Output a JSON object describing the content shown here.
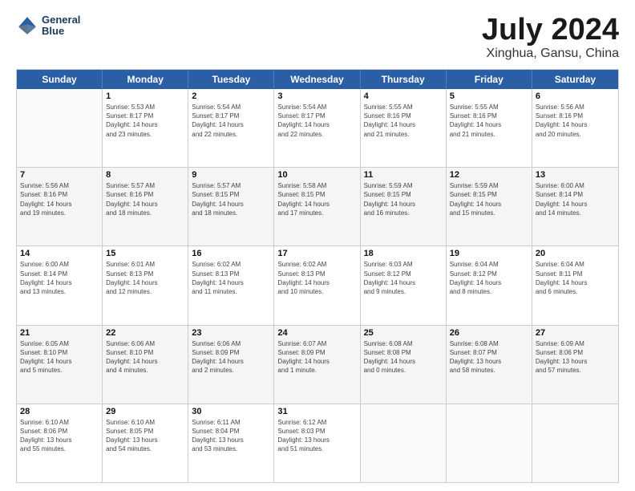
{
  "header": {
    "logo_line1": "General",
    "logo_line2": "Blue",
    "title": "July 2024",
    "subtitle": "Xinghua, Gansu, China"
  },
  "weekdays": [
    "Sunday",
    "Monday",
    "Tuesday",
    "Wednesday",
    "Thursday",
    "Friday",
    "Saturday"
  ],
  "rows": [
    [
      {
        "num": "",
        "info": ""
      },
      {
        "num": "1",
        "info": "Sunrise: 5:53 AM\nSunset: 8:17 PM\nDaylight: 14 hours\nand 23 minutes."
      },
      {
        "num": "2",
        "info": "Sunrise: 5:54 AM\nSunset: 8:17 PM\nDaylight: 14 hours\nand 22 minutes."
      },
      {
        "num": "3",
        "info": "Sunrise: 5:54 AM\nSunset: 8:17 PM\nDaylight: 14 hours\nand 22 minutes."
      },
      {
        "num": "4",
        "info": "Sunrise: 5:55 AM\nSunset: 8:16 PM\nDaylight: 14 hours\nand 21 minutes."
      },
      {
        "num": "5",
        "info": "Sunrise: 5:55 AM\nSunset: 8:16 PM\nDaylight: 14 hours\nand 21 minutes."
      },
      {
        "num": "6",
        "info": "Sunrise: 5:56 AM\nSunset: 8:16 PM\nDaylight: 14 hours\nand 20 minutes."
      }
    ],
    [
      {
        "num": "7",
        "info": "Sunrise: 5:56 AM\nSunset: 8:16 PM\nDaylight: 14 hours\nand 19 minutes."
      },
      {
        "num": "8",
        "info": "Sunrise: 5:57 AM\nSunset: 8:16 PM\nDaylight: 14 hours\nand 18 minutes."
      },
      {
        "num": "9",
        "info": "Sunrise: 5:57 AM\nSunset: 8:15 PM\nDaylight: 14 hours\nand 18 minutes."
      },
      {
        "num": "10",
        "info": "Sunrise: 5:58 AM\nSunset: 8:15 PM\nDaylight: 14 hours\nand 17 minutes."
      },
      {
        "num": "11",
        "info": "Sunrise: 5:59 AM\nSunset: 8:15 PM\nDaylight: 14 hours\nand 16 minutes."
      },
      {
        "num": "12",
        "info": "Sunrise: 5:59 AM\nSunset: 8:15 PM\nDaylight: 14 hours\nand 15 minutes."
      },
      {
        "num": "13",
        "info": "Sunrise: 6:00 AM\nSunset: 8:14 PM\nDaylight: 14 hours\nand 14 minutes."
      }
    ],
    [
      {
        "num": "14",
        "info": "Sunrise: 6:00 AM\nSunset: 8:14 PM\nDaylight: 14 hours\nand 13 minutes."
      },
      {
        "num": "15",
        "info": "Sunrise: 6:01 AM\nSunset: 8:13 PM\nDaylight: 14 hours\nand 12 minutes."
      },
      {
        "num": "16",
        "info": "Sunrise: 6:02 AM\nSunset: 8:13 PM\nDaylight: 14 hours\nand 11 minutes."
      },
      {
        "num": "17",
        "info": "Sunrise: 6:02 AM\nSunset: 8:13 PM\nDaylight: 14 hours\nand 10 minutes."
      },
      {
        "num": "18",
        "info": "Sunrise: 6:03 AM\nSunset: 8:12 PM\nDaylight: 14 hours\nand 9 minutes."
      },
      {
        "num": "19",
        "info": "Sunrise: 6:04 AM\nSunset: 8:12 PM\nDaylight: 14 hours\nand 8 minutes."
      },
      {
        "num": "20",
        "info": "Sunrise: 6:04 AM\nSunset: 8:11 PM\nDaylight: 14 hours\nand 6 minutes."
      }
    ],
    [
      {
        "num": "21",
        "info": "Sunrise: 6:05 AM\nSunset: 8:10 PM\nDaylight: 14 hours\nand 5 minutes."
      },
      {
        "num": "22",
        "info": "Sunrise: 6:06 AM\nSunset: 8:10 PM\nDaylight: 14 hours\nand 4 minutes."
      },
      {
        "num": "23",
        "info": "Sunrise: 6:06 AM\nSunset: 8:09 PM\nDaylight: 14 hours\nand 2 minutes."
      },
      {
        "num": "24",
        "info": "Sunrise: 6:07 AM\nSunset: 8:09 PM\nDaylight: 14 hours\nand 1 minute."
      },
      {
        "num": "25",
        "info": "Sunrise: 6:08 AM\nSunset: 8:08 PM\nDaylight: 14 hours\nand 0 minutes."
      },
      {
        "num": "26",
        "info": "Sunrise: 6:08 AM\nSunset: 8:07 PM\nDaylight: 13 hours\nand 58 minutes."
      },
      {
        "num": "27",
        "info": "Sunrise: 6:09 AM\nSunset: 8:06 PM\nDaylight: 13 hours\nand 57 minutes."
      }
    ],
    [
      {
        "num": "28",
        "info": "Sunrise: 6:10 AM\nSunset: 8:06 PM\nDaylight: 13 hours\nand 55 minutes."
      },
      {
        "num": "29",
        "info": "Sunrise: 6:10 AM\nSunset: 8:05 PM\nDaylight: 13 hours\nand 54 minutes."
      },
      {
        "num": "30",
        "info": "Sunrise: 6:11 AM\nSunset: 8:04 PM\nDaylight: 13 hours\nand 53 minutes."
      },
      {
        "num": "31",
        "info": "Sunrise: 6:12 AM\nSunset: 8:03 PM\nDaylight: 13 hours\nand 51 minutes."
      },
      {
        "num": "",
        "info": ""
      },
      {
        "num": "",
        "info": ""
      },
      {
        "num": "",
        "info": ""
      }
    ]
  ]
}
